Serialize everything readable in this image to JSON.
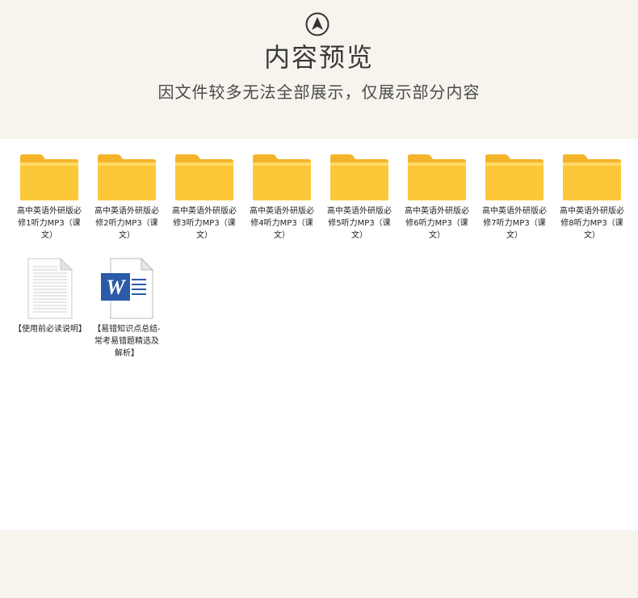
{
  "header": {
    "logo_icon": "navigation-arrow-icon",
    "title": "内容预览",
    "subtitle": "因文件较多无法全部展示，仅展示部分内容"
  },
  "folders": [
    {
      "label": "高中英语外研版必修1听力MP3（课文）"
    },
    {
      "label": "高中英语外研版必修2听力MP3（课文）"
    },
    {
      "label": "高中英语外研版必修3听力MP3（课文）"
    },
    {
      "label": "高中英语外研版必修4听力MP3（课文）"
    },
    {
      "label": "高中英语外研版必修5听力MP3（课文）"
    },
    {
      "label": "高中英语外研版必修6听力MP3（课文）"
    },
    {
      "label": "高中英语外研版必修7听力MP3（课文）"
    },
    {
      "label": "高中英语外研版必修8听力MP3（课文）"
    }
  ],
  "files": [
    {
      "label": "【使用前必读说明】",
      "icon": "text-document-icon"
    },
    {
      "label": "【易错知识点总结-常考易错题精选及解析】",
      "icon": "word-document-icon"
    }
  ],
  "colors": {
    "folder": "#fcc83a",
    "word": "#2a5aa8"
  }
}
